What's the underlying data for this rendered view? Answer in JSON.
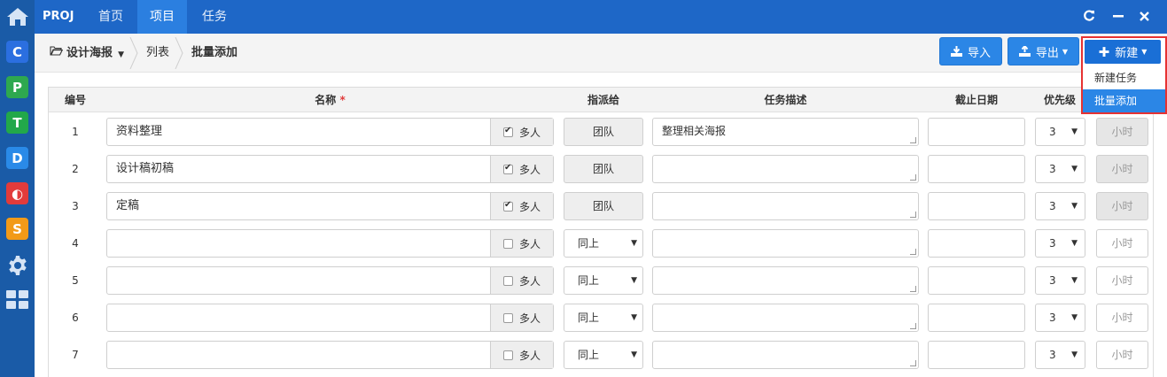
{
  "app": {
    "brand": "PROJ",
    "nav": [
      {
        "label": "首页"
      },
      {
        "label": "项目"
      },
      {
        "label": "任务"
      }
    ],
    "colors": {
      "topbar": "#1e67c7",
      "rail": "#1a5ba7",
      "accent": "#2b86e6",
      "highlight_border": "#e63232"
    }
  },
  "rail": {
    "apps": [
      {
        "letter": "C",
        "color": "#2b6fe0",
        "icon": "c-app-icon"
      },
      {
        "letter": "P",
        "color": "#2ea84f",
        "icon": "p-app-icon"
      },
      {
        "letter": "T",
        "color": "#22a84a",
        "icon": "t-app-icon"
      },
      {
        "letter": "D",
        "color": "#2a8ae8",
        "icon": "d-app-icon"
      },
      {
        "letter": "◐",
        "color": "#e23b3b",
        "icon": "o-app-icon"
      },
      {
        "letter": "S",
        "color": "#f29a18",
        "icon": "s-app-icon"
      }
    ]
  },
  "breadcrumb": {
    "project": "设计海报",
    "list": "列表",
    "current": "批量添加"
  },
  "toolbar": {
    "import_label": "导入",
    "export_label": "导出",
    "new_label": "新建"
  },
  "new_menu": {
    "items": [
      {
        "label": "新建任务"
      },
      {
        "label": "批量添加"
      }
    ]
  },
  "table": {
    "headers": {
      "num": "编号",
      "name": "名称",
      "required_mark": "*",
      "assign": "指派给",
      "desc": "任务描述",
      "deadline": "截止日期",
      "priority": "优先级"
    },
    "multi_label": "多人",
    "hours_placeholder": "小时",
    "rows": [
      {
        "num": "1",
        "name": "资料整理",
        "multi": true,
        "assign": "团队",
        "assign_mode": "team",
        "desc": "整理相关海报",
        "priority": "3"
      },
      {
        "num": "2",
        "name": "设计稿初稿",
        "multi": true,
        "assign": "团队",
        "assign_mode": "team",
        "desc": "",
        "priority": "3"
      },
      {
        "num": "3",
        "name": "定稿",
        "multi": true,
        "assign": "团队",
        "assign_mode": "team",
        "desc": "",
        "priority": "3"
      },
      {
        "num": "4",
        "name": "",
        "multi": false,
        "assign": "同上",
        "assign_mode": "select",
        "desc": "",
        "priority": "3"
      },
      {
        "num": "5",
        "name": "",
        "multi": false,
        "assign": "同上",
        "assign_mode": "select",
        "desc": "",
        "priority": "3"
      },
      {
        "num": "6",
        "name": "",
        "multi": false,
        "assign": "同上",
        "assign_mode": "select",
        "desc": "",
        "priority": "3"
      },
      {
        "num": "7",
        "name": "",
        "multi": false,
        "assign": "同上",
        "assign_mode": "select",
        "desc": "",
        "priority": "3"
      }
    ]
  }
}
